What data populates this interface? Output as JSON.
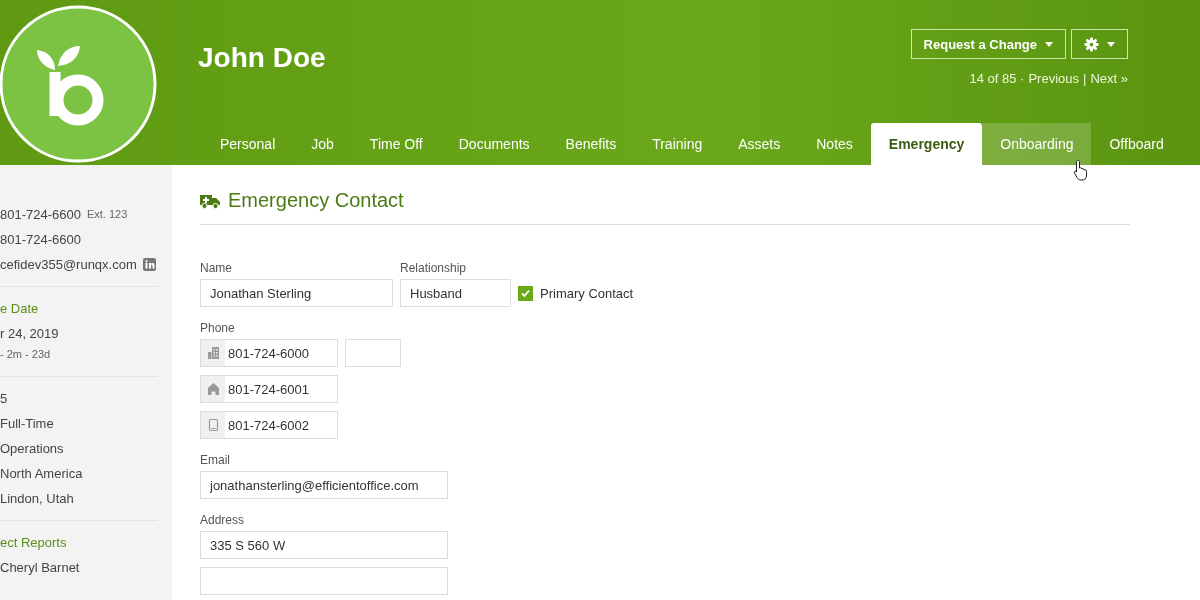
{
  "header": {
    "name": "John Doe",
    "request_button": "Request a Change",
    "pager": {
      "position": "14 of 85 ·",
      "previous": "Previous",
      "separator": "|",
      "next": "Next »"
    }
  },
  "tabs": [
    {
      "label": "Personal",
      "selected": false,
      "hovered": false
    },
    {
      "label": "Job",
      "selected": false,
      "hovered": false
    },
    {
      "label": "Time Off",
      "selected": false,
      "hovered": false
    },
    {
      "label": "Documents",
      "selected": false,
      "hovered": false
    },
    {
      "label": "Benefits",
      "selected": false,
      "hovered": false
    },
    {
      "label": "Training",
      "selected": false,
      "hovered": false
    },
    {
      "label": "Assets",
      "selected": false,
      "hovered": false
    },
    {
      "label": "Notes",
      "selected": false,
      "hovered": false
    },
    {
      "label": "Emergency",
      "selected": true,
      "hovered": false
    },
    {
      "label": "Onboarding",
      "selected": false,
      "hovered": true
    },
    {
      "label": "Offboard",
      "selected": false,
      "hovered": false
    }
  ],
  "sidebar": {
    "groups": [
      [
        {
          "kind": "phone",
          "text": "801-724-6600",
          "extra": "Ext. 123"
        },
        {
          "kind": "phone",
          "text": "801-724-6600"
        },
        {
          "kind": "email",
          "text": "cefidev355@runqx.com"
        }
      ],
      [
        {
          "kind": "heading",
          "text": "e Date"
        },
        {
          "kind": "text",
          "text": "r 24, 2019"
        },
        {
          "kind": "small",
          "text": "- 2m - 23d"
        }
      ],
      [
        {
          "kind": "text",
          "text": "5"
        },
        {
          "kind": "text",
          "text": "Full-Time"
        },
        {
          "kind": "text",
          "text": "Operations"
        },
        {
          "kind": "text",
          "text": "North America"
        },
        {
          "kind": "text",
          "text": "Lindon, Utah"
        }
      ],
      [
        {
          "kind": "heading",
          "text": "ect Reports"
        },
        {
          "kind": "text",
          "text": "Cheryl Barnet"
        }
      ]
    ]
  },
  "section": {
    "title": "Emergency Contact",
    "name": {
      "label": "Name",
      "value": "Jonathan Sterling"
    },
    "relationship": {
      "label": "Relationship",
      "value": "Husband"
    },
    "primary": {
      "label": "Primary Contact",
      "checked": true
    },
    "phone": {
      "label": "Phone",
      "numbers": [
        {
          "kind": "work",
          "value": "801-724-6000",
          "has_extension": true
        },
        {
          "kind": "home",
          "value": "801-724-6001",
          "has_extension": false
        },
        {
          "kind": "mobile",
          "value": "801-724-6002",
          "has_extension": false
        }
      ]
    },
    "email": {
      "label": "Email",
      "value": "jonathansterling@efficientoffice.com"
    },
    "address": {
      "label": "Address",
      "value": "335 S 560 W"
    }
  }
}
